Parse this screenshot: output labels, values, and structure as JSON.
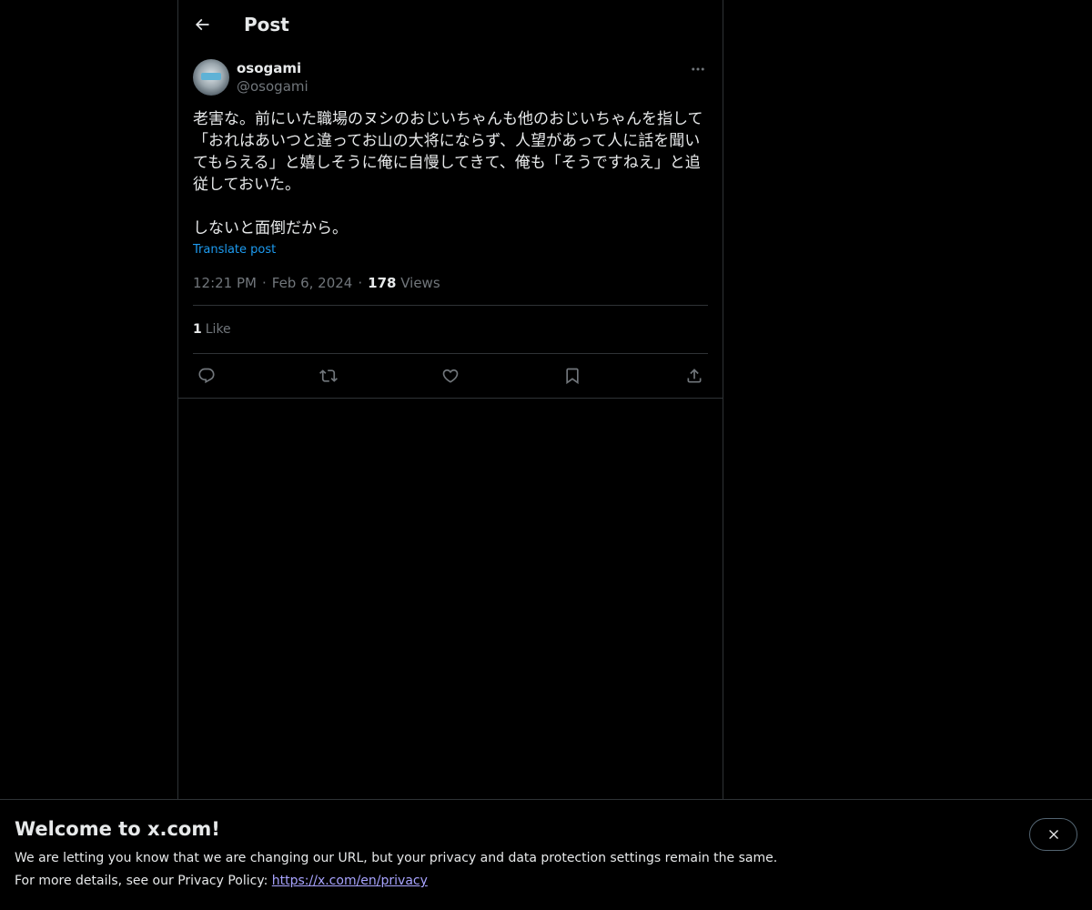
{
  "header": {
    "title": "Post"
  },
  "post": {
    "display_name": "osogami",
    "handle": "@osogami",
    "text": "老害な。前にいた職場のヌシのおじいちゃんも他のおじいちゃんを指して「おれはあいつと違ってお山の大将にならず、人望があって人に話を聞いてもらえる」と嬉しそうに俺に自慢してきて、俺も「そうですねえ」と追従しておいた。\n\nしないと面倒だから。",
    "translate_label": "Translate post",
    "time": "12:21 PM",
    "date": "Feb 6, 2024",
    "views_count": "178",
    "views_label": "Views",
    "likes_count": "1",
    "likes_label": "Like"
  },
  "icons": {
    "back": "arrow-left-icon",
    "more": "more-horizontal-icon",
    "reply": "reply-icon",
    "repost": "repost-icon",
    "like": "heart-icon",
    "bookmark": "bookmark-icon",
    "share": "share-icon",
    "close": "close-icon"
  },
  "banner": {
    "title": "Welcome to x.com!",
    "line1": "We are letting you know that we are changing our URL, but your privacy and data protection settings remain the same.",
    "line2_prefix": "For more details, see our Privacy Policy: ",
    "link_text": "https://x.com/en/privacy"
  },
  "colors": {
    "background": "#000000",
    "text": "#e7e9ea",
    "muted": "#71767b",
    "accent": "#1d9bf0",
    "border": "#2f3336"
  }
}
